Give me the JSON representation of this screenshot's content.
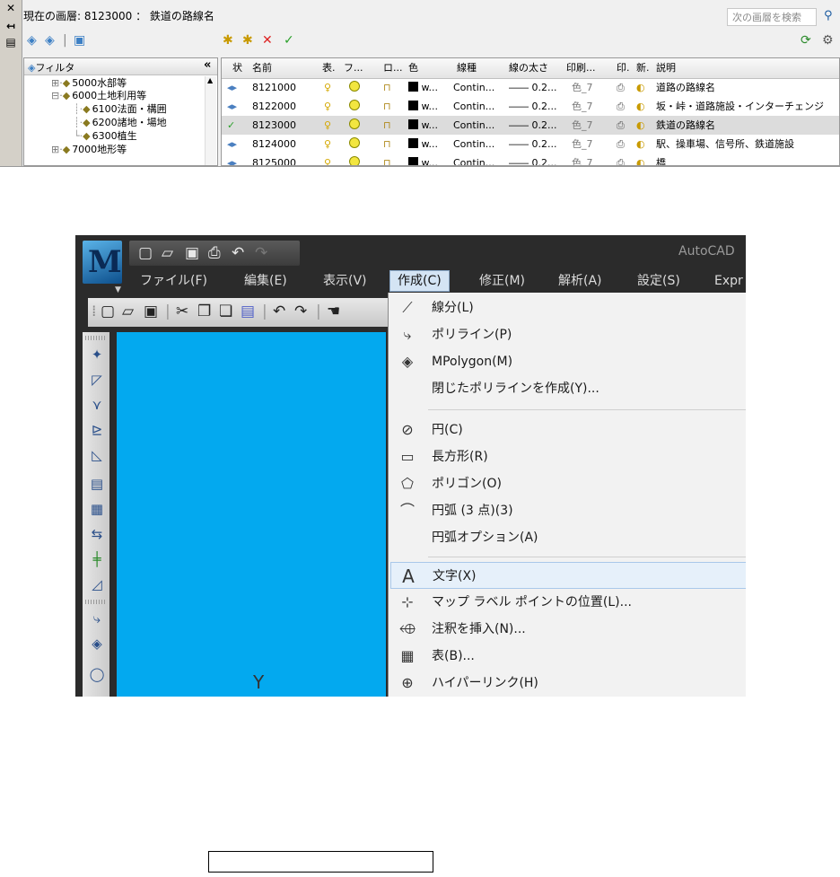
{
  "layer_manager": {
    "current_layer": "現在の画層: 8123000 ： 鉄道の路線名",
    "search_placeholder": "次の画層を検索",
    "side_buttons": [
      "close-icon",
      "pin-icon",
      "properties-icon"
    ],
    "filter_title": "フィルタ",
    "filter_collapse": "«",
    "tree": [
      {
        "label": "5000水部等",
        "level": 0
      },
      {
        "label": "6000土地利用等",
        "level": 0
      },
      {
        "label": "6100法面・構囲",
        "level": 1
      },
      {
        "label": "6200諸地・場地",
        "level": 1
      },
      {
        "label": "6300植生",
        "level": 1
      },
      {
        "label": "7000地形等",
        "level": 0
      }
    ],
    "columns": [
      "状",
      "名前",
      "表.",
      "フ...",
      "ロ...",
      "色",
      "線種",
      "線の太さ",
      "印刷...",
      "印.",
      "新.",
      "説明"
    ],
    "rows": [
      {
        "name": "8121000",
        "color": "w...",
        "linetype": "Contin...",
        "lineweight": "―― 0.2...",
        "plot_style": "色_7",
        "description": "道路の路線名",
        "current": false
      },
      {
        "name": "8122000",
        "color": "w...",
        "linetype": "Contin...",
        "lineweight": "―― 0.2...",
        "plot_style": "色_7",
        "description": "坂・峠・道路施設・インターチェンジ",
        "current": false
      },
      {
        "name": "8123000",
        "color": "w...",
        "linetype": "Contin...",
        "lineweight": "―― 0.2...",
        "plot_style": "色_7",
        "description": "鉄道の路線名",
        "current": true
      },
      {
        "name": "8124000",
        "color": "w...",
        "linetype": "Contin...",
        "lineweight": "―― 0.2...",
        "plot_style": "色_7",
        "description": "駅、操車場、信号所、鉄道施設",
        "current": false
      },
      {
        "name": "8125000",
        "color": "w...",
        "linetype": "Contin...",
        "lineweight": "―― 0.2...",
        "plot_style": "色_7",
        "description": "橋",
        "current": false
      }
    ]
  },
  "autocad": {
    "title": "AutoCAD",
    "menus": [
      "ファイル(F)",
      "編集(E)",
      "表示(V)",
      "作成(C)",
      "修正(M)",
      "解析(A)",
      "設定(S)",
      "Expr"
    ],
    "active_menu": "作成(C)",
    "dropdown": [
      {
        "label": "線分(L)",
        "icon": "line-icon"
      },
      {
        "label": "ポリライン(P)",
        "icon": "polyline-icon"
      },
      {
        "label": "MPolygon(M)",
        "icon": "mpolygon-icon"
      },
      {
        "label": "閉じたポリラインを作成(Y)...",
        "icon": ""
      },
      {
        "label": "円(C)",
        "icon": "circle-icon"
      },
      {
        "label": "長方形(R)",
        "icon": "rectangle-icon"
      },
      {
        "label": "ポリゴン(O)",
        "icon": "polygon-icon"
      },
      {
        "label": "円弧 (3 点)(3)",
        "icon": "arc-icon"
      },
      {
        "label": "円弧オプション(A)",
        "icon": ""
      },
      {
        "label": "文字(X)",
        "icon": "text-icon"
      },
      {
        "label": "マップ ラベル ポイントの位置(L)...",
        "icon": "map-label-icon"
      },
      {
        "label": "注釈を挿入(N)...",
        "icon": "annotation-icon"
      },
      {
        "label": "表(B)...",
        "icon": "table-icon"
      },
      {
        "label": "ハイパーリンク(H)",
        "icon": "hyperlink-icon"
      }
    ],
    "highlighted_item": "文字(X)",
    "canvas_color": "#03a9ef"
  }
}
